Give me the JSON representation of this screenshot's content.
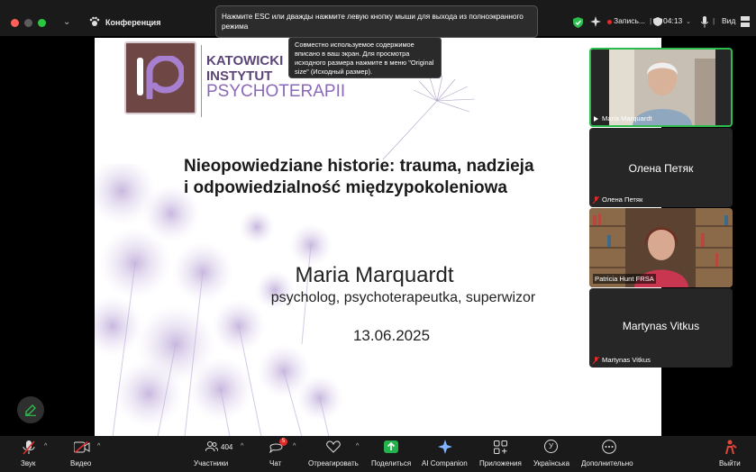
{
  "window": {
    "title": "Конференция"
  },
  "banner": {
    "text": "Нажмите ESC или дважды нажмите левую кнопку мыши для выхода из полноэкранного режима"
  },
  "tooltip": {
    "text": "Совместно используемое содержимое вписано в ваш экран. Для просмотра исходного размера нажмите в меню \"Original size\" (Исходный размер)."
  },
  "status": {
    "recording": "Запись...",
    "time": "04:13",
    "view": "Вид"
  },
  "slide": {
    "logo": {
      "line1": "KATOWICKI",
      "line2": "INSTYTUT",
      "line3": "PSYCHOTERAPII"
    },
    "title_line1": "Nieopowiedziane historie: trauma, nadzieja",
    "title_line2": "i odpowiedzialność międzypokoleniowa",
    "speaker": "Maria Marquardt",
    "role": "psycholog, psychoterapeutka, superwizor",
    "date": "13.06.2025"
  },
  "participants": [
    {
      "name": "Maria Marquardt",
      "video": true,
      "active": true
    },
    {
      "name": "Олена Петяк",
      "video": false,
      "active": false
    },
    {
      "name": "Patricia Hunt FRSA",
      "video": true,
      "active": false
    },
    {
      "name": "Martynas Vitkus",
      "video": false,
      "active": false
    }
  ],
  "toolbar": {
    "audio": "Звук",
    "video": "Видео",
    "participants": "Участники",
    "participants_count": "404",
    "chat": "Чат",
    "chat_badge": "5",
    "react": "Отреагировать",
    "share": "Поделиться",
    "ai": "AI Companion",
    "apps": "Приложения",
    "language": "Українська",
    "language_code": "У",
    "more": "Дополнительно",
    "leave": "Выйти"
  },
  "colors": {
    "active_border": "#2dbb4e",
    "share_green": "#23b24b",
    "logo_purple": "#6a4c8c",
    "logo_box": "#6e4744",
    "record_red": "#e02b2b"
  }
}
